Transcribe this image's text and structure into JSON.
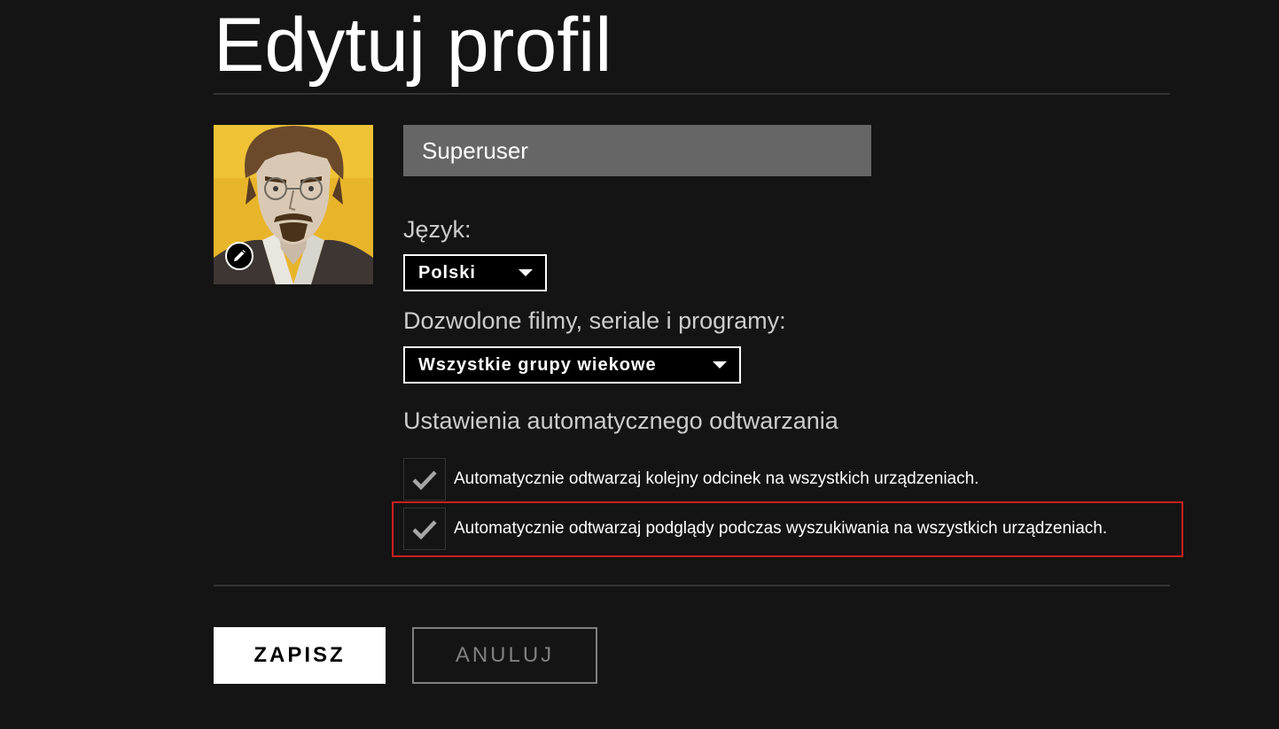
{
  "page": {
    "title": "Edytuj profil"
  },
  "profile": {
    "name_value": "Superuser",
    "avatar_icon": "anime-avatar-glasses-beard",
    "edit_icon": "pencil-icon"
  },
  "language": {
    "label": "Język:",
    "selected": "Polski"
  },
  "maturity": {
    "label": "Dozwolone filmy, seriale i programy:",
    "selected": "Wszystkie grupy wiekowe"
  },
  "autoplay": {
    "heading": "Ustawienia automatycznego odtwarzania",
    "options": [
      {
        "label": "Automatycznie odtwarzaj kolejny odcinek na wszystkich urządzeniach.",
        "checked": true
      },
      {
        "label": "Automatycznie odtwarzaj podglądy podczas wyszukiwania na wszystkich urządzeniach.",
        "checked": true
      }
    ]
  },
  "actions": {
    "save_label": "ZAPISZ",
    "cancel_label": "ANULUJ"
  },
  "colors": {
    "background": "#141414",
    "input_bg": "#666666",
    "highlight_border": "#cc1f1f",
    "avatar_bg": "#e8b52a"
  }
}
